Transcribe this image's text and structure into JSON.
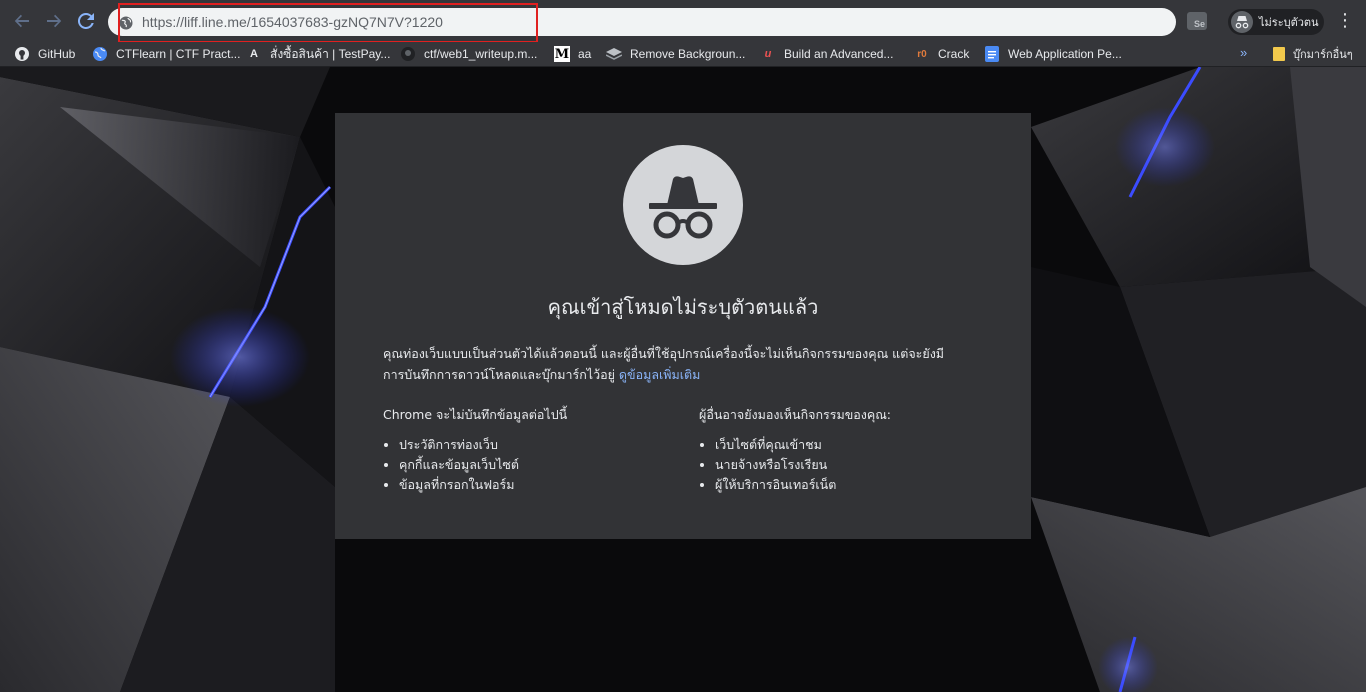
{
  "toolbar": {
    "back_icon": "back-arrow-icon",
    "forward_icon": "forward-arrow-icon",
    "reload_icon": "reload-icon",
    "url": "https://liff.line.me/1654037683-gzNQ7N7V?1220",
    "extension_label": "Se",
    "profile_label": "ไม่ระบุตัวตน"
  },
  "bookmarks": {
    "items": [
      {
        "label": "GitHub",
        "icon": "github-icon"
      },
      {
        "label": "CTFlearn | CTF Pract...",
        "icon": "globe-icon"
      },
      {
        "label": "สั่งซื้อสินค้า | TestPay...",
        "icon": "letter-a-icon"
      },
      {
        "label": "ctf/web1_writeup.m...",
        "icon": "github-icon"
      },
      {
        "label": "aa",
        "icon": "medium-icon"
      },
      {
        "label": "Remove Backgroun...",
        "icon": "layers-icon"
      },
      {
        "label": "Build an Advanced...",
        "icon": "udemy-icon"
      },
      {
        "label": "Crack",
        "icon": "r0-icon"
      },
      {
        "label": "Web Application Pe...",
        "icon": "docs-icon"
      }
    ],
    "more": "»",
    "other_folder": "บุ๊กมาร์กอื่นๆ"
  },
  "incognito": {
    "icon": "incognito-icon",
    "title": "คุณเข้าสู่โหมดไม่ระบุตัวตนแล้ว",
    "intro_line1": "คุณท่องเว็บแบบเป็นส่วนตัวได้แล้วตอนนี้ และผู้อื่นที่ใช้อุปกรณ์เครื่องนี้จะไม่เห็นกิจกรรมของคุณ แต่จะยังมี",
    "intro_line2": "การบันทึกการดาวน์โหลดและบุ๊กมาร์กไว้อยู่",
    "learn_more": "ดูข้อมูลเพิ่มเติม",
    "left_heading": "Chrome จะไม่บันทึกข้อมูลต่อไปนี้",
    "left_items": [
      "ประวัติการท่องเว็บ",
      "คุกกี้และข้อมูลเว็บไซต์",
      "ข้อมูลที่กรอกในฟอร์ม"
    ],
    "right_heading": "ผู้อื่นอาจยังมองเห็นกิจกรรมของคุณ:",
    "right_items": [
      "เว็บไซต์ที่คุณเข้าชม",
      "นายจ้างหรือโรงเรียน",
      "ผู้ให้บริการอินเทอร์เน็ต"
    ]
  },
  "colors": {
    "toolbar_bg": "#35363a",
    "panel_bg": "#323336",
    "link": "#8ab4f8",
    "highlight": "#e02020",
    "accent_blue": "#3b4cff"
  }
}
